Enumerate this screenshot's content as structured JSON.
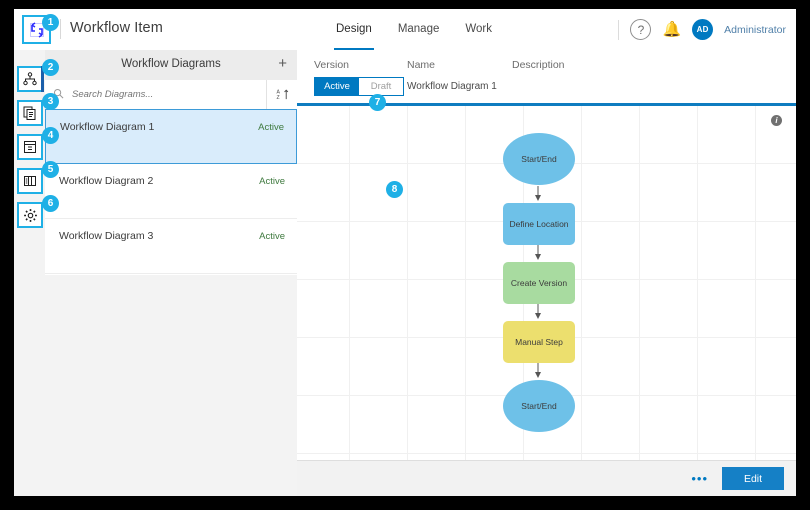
{
  "header": {
    "app_title": "Workflow Item",
    "logo_icon": "workflow-arrows-icon",
    "nav": [
      {
        "label": "Design",
        "active": true
      },
      {
        "label": "Manage",
        "active": false
      },
      {
        "label": "Work",
        "active": false
      }
    ],
    "help_icon": "question-circle-icon",
    "notifications_icon": "bell-icon",
    "avatar_initials": "AD",
    "user_name": "Administrator"
  },
  "rail": {
    "items": [
      {
        "name": "diagrams-icon",
        "active": true
      },
      {
        "name": "copy-icon",
        "active": false
      },
      {
        "name": "archive-icon",
        "active": false
      },
      {
        "name": "table-icon",
        "active": false
      },
      {
        "name": "settings-gear-icon",
        "active": false
      }
    ]
  },
  "list_panel": {
    "title": "Workflow Diagrams",
    "add_label": "+",
    "search": {
      "placeholder": "Search Diagrams...",
      "value": "",
      "icon": "search-icon"
    },
    "sort_icon": "sort-alpha-ascending-icon",
    "rows": [
      {
        "name": "Workflow Diagram 1",
        "status": "Active",
        "selected": true
      },
      {
        "name": "Workflow Diagram 2",
        "status": "Active",
        "selected": false
      },
      {
        "name": "Workflow Diagram 3",
        "status": "Active",
        "selected": false
      }
    ]
  },
  "detail": {
    "columns": {
      "version": "Version",
      "name": "Name",
      "description": "Description"
    },
    "version_toggle": {
      "active": "Active",
      "draft": "Draft",
      "selected": "Active"
    },
    "name_value": "Workflow Diagram 1",
    "description_value": "",
    "info_icon": "info-icon",
    "footer": {
      "more_label": "•••",
      "edit_label": "Edit"
    }
  },
  "diagram": {
    "nodes": [
      {
        "label": "Start/End",
        "shape": "ellipse",
        "color": "#6ec1e8"
      },
      {
        "label": "Define Location",
        "shape": "rect",
        "color": "#6ec1e8"
      },
      {
        "label": "Create Version",
        "shape": "rect",
        "color": "#a8dba0"
      },
      {
        "label": "Manual Step",
        "shape": "rect",
        "color": "#ecdf6e"
      },
      {
        "label": "Start/End",
        "shape": "ellipse",
        "color": "#6ec1e8"
      }
    ]
  },
  "callouts": [
    {
      "num": "1"
    },
    {
      "num": "2"
    },
    {
      "num": "3"
    },
    {
      "num": "4"
    },
    {
      "num": "5"
    },
    {
      "num": "6"
    },
    {
      "num": "7"
    },
    {
      "num": "8"
    }
  ]
}
